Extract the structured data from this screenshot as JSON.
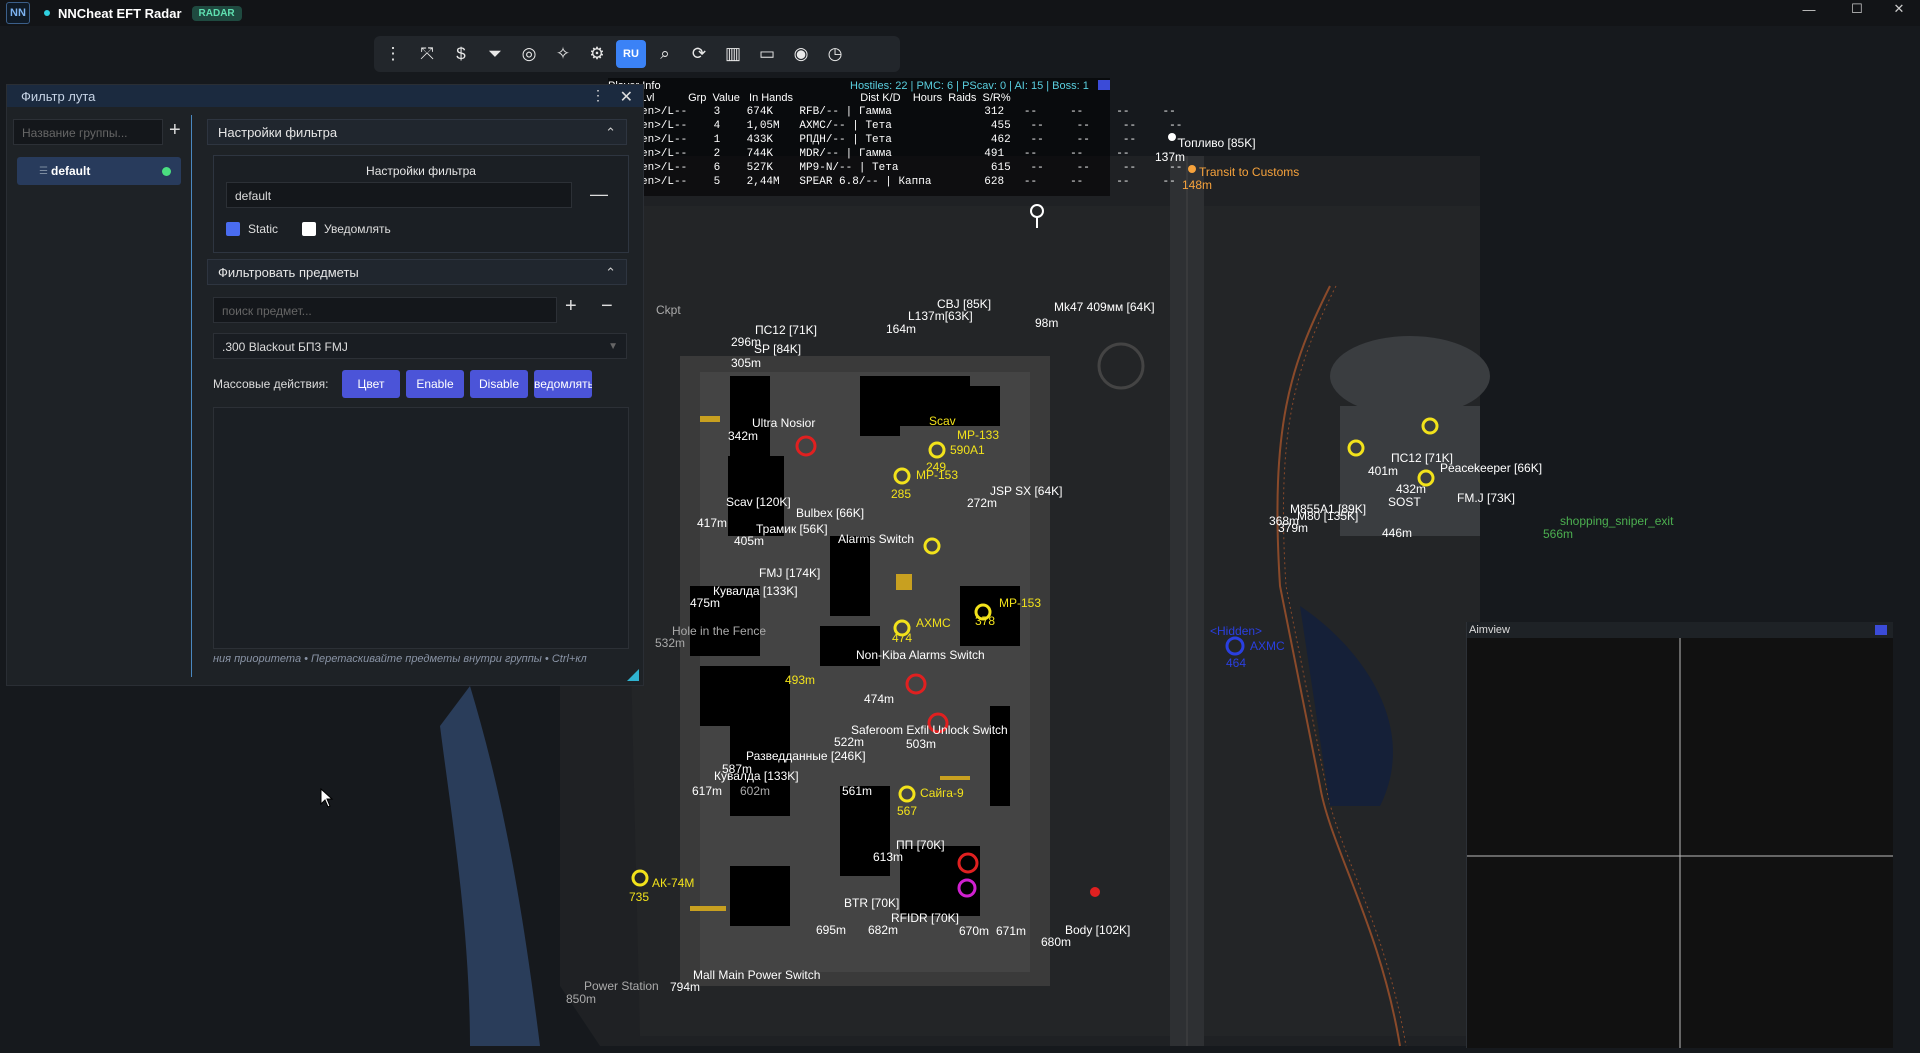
{
  "app": {
    "logo": "NN",
    "title": "NNCheat EFT Radar",
    "badge": "RADAR",
    "win_min": "—",
    "win_max": "☐",
    "win_close": "✕"
  },
  "toolbar": {
    "lang": "RU",
    "icons": [
      "menu-dots-icon",
      "crosshair-icon",
      "dollar-icon",
      "filter-icon",
      "glasses-icon",
      "magic-wand-icon",
      "gear-icon",
      "lang-toggle",
      "search-icon",
      "refresh-icon",
      "map-icon",
      "window-icon",
      "eye-icon",
      "clock-icon"
    ]
  },
  "loot_filter": {
    "title": "Фильтр лута",
    "group_placeholder": "Название группы...",
    "group_name": "default",
    "settings_header": "Настройки фильтра",
    "settings_box_title": "Настройки фильтра",
    "filter_name_value": "default",
    "static_label": "Static",
    "static_checked": true,
    "notify_label": "Уведомлять",
    "notify_checked": false,
    "items_header": "Фильтровать предметы",
    "item_search_placeholder": "поиск предмет...",
    "selected_item": ".300 Blackout БП3 FMJ",
    "mass_label": "Массовые действия:",
    "btn_color": "Цвет",
    "btn_enable": "Enable",
    "btn_disable": "Disable",
    "btn_notify": "ведомлять",
    "hint": "ния приоритета • Перетаскивайте предметы внутри группы • Ctrl+кл"
  },
  "player_info": {
    "header": "Player Info",
    "stats": "Hostiles: 22 | PMC: 6 | PScav: 0 | AI: 15 | Boss: 1",
    "columns": "Name/Lvl           Grp  Value   In Hands                      Dist K/D    Hours  Raids  S/R%",
    "rows": [
      "<Hidden>/L--    3    674K    RFB/-- | Гамма              312   --     --     --     --",
      "<Hidden>/L--    4    1,05M   AXMC/-- | Тета               455   --     --     --     --",
      "<Hidden>/L--    1    433K    РПДН/-- | Тета               462   --     --     --     --",
      "<Hidden>/L--    2    744K    MDR/-- | Гамма              491   --     --     --     --",
      "<Hidden>/L--    6    527K    MP9-N/-- | Тета              615   --     --     --     --",
      "<Hidden>/L--    5    2,44M   SPEAR 6.8/-- | Каппа        628   --     --     --     --"
    ]
  },
  "aimview": {
    "title": "Aimview"
  },
  "map_labels": [
    {
      "t": "Топливо [85K]",
      "c": "#fff"
    },
    {
      "t": "137m",
      "c": "#fff"
    },
    {
      "t": "Transit to Customs",
      "c": "#f6a23c"
    },
    {
      "t": "148m",
      "c": "#f6a23c"
    },
    {
      "t": "CBJ [85K]",
      "c": "#fff"
    },
    {
      "t": "L137m[63K]",
      "c": "#fff"
    },
    {
      "t": "164m",
      "c": "#fff"
    },
    {
      "t": "Mk47 409мм [64K]",
      "c": "#fff"
    },
    {
      "t": "98m",
      "c": "#fff"
    },
    {
      "t": "ПС12 [71K]",
      "c": "#fff"
    },
    {
      "t": "296m",
      "c": "#fff"
    },
    {
      "t": "SP [84K]",
      "c": "#fff"
    },
    {
      "t": "305m",
      "c": "#fff"
    },
    {
      "t": "Ultra Nosior",
      "c": "#fff"
    },
    {
      "t": "342m",
      "c": "#fff"
    },
    {
      "t": "Scav",
      "c": "#f2e21b"
    },
    {
      "t": "MP-133",
      "c": "#f2e21b"
    },
    {
      "t": "590A1",
      "c": "#f2e21b"
    },
    {
      "t": "249",
      "c": "#f2e21b"
    },
    {
      "t": "MP-153",
      "c": "#f2e21b"
    },
    {
      "t": "285",
      "c": "#f2e21b"
    },
    {
      "t": "JSP SX [64K]",
      "c": "#fff"
    },
    {
      "t": "272m",
      "c": "#fff"
    },
    {
      "t": "Bulbex [66K]",
      "c": "#fff"
    },
    {
      "t": "Трамик [56K]",
      "c": "#fff"
    },
    {
      "t": "405m",
      "c": "#fff"
    },
    {
      "t": "Alarms Switch",
      "c": "#fff"
    },
    {
      "t": "FMJ [174K]",
      "c": "#fff"
    },
    {
      "t": "Кувалда [133K]",
      "c": "#fff"
    },
    {
      "t": "475m",
      "c": "#fff"
    },
    {
      "t": "Hole in the Fence",
      "c": "#aaa"
    },
    {
      "t": "532m",
      "c": "#aaa"
    },
    {
      "t": "МР-153",
      "c": "#f2e21b"
    },
    {
      "t": "378",
      "c": "#f2e21b"
    },
    {
      "t": "Non-Kiba Alarms Switch",
      "c": "#fff"
    },
    {
      "t": "493m",
      "c": "#f2e21b"
    },
    {
      "t": "474m",
      "c": "#fff"
    },
    {
      "t": "Saferoom Exfil Unlock Switch",
      "c": "#fff"
    },
    {
      "t": "522m",
      "c": "#fff"
    },
    {
      "t": "503m",
      "c": "#fff"
    },
    {
      "t": "Разведданные [246K]",
      "c": "#fff"
    },
    {
      "t": "587m",
      "c": "#fff"
    },
    {
      "t": "Кувалда [133K]",
      "c": "#fff"
    },
    {
      "t": "617m",
      "c": "#fff"
    },
    {
      "t": "602m",
      "c": "#aaa"
    },
    {
      "t": "561m",
      "c": "#fff"
    },
    {
      "t": "Сайга-9",
      "c": "#f2e21b"
    },
    {
      "t": "567",
      "c": "#f2e21b"
    },
    {
      "t": "ПП [70K]",
      "c": "#fff"
    },
    {
      "t": "613m",
      "c": "#fff"
    },
    {
      "t": "АК-74М",
      "c": "#f2e21b"
    },
    {
      "t": "735",
      "c": "#f2e21b"
    },
    {
      "t": "BTR [70K]",
      "c": "#fff"
    },
    {
      "t": "RFIDR [70K]",
      "c": "#fff"
    },
    {
      "t": "695m",
      "c": "#fff"
    },
    {
      "t": "682m",
      "c": "#fff"
    },
    {
      "t": "670m",
      "c": "#fff"
    },
    {
      "t": "671m",
      "c": "#fff"
    },
    {
      "t": "Body [102K]",
      "c": "#fff"
    },
    {
      "t": "680m",
      "c": "#fff"
    },
    {
      "t": "Mall Main Power Switch",
      "c": "#fff"
    },
    {
      "t": "794m",
      "c": "#fff"
    },
    {
      "t": "Power Station",
      "c": "#aaa"
    },
    {
      "t": "850m",
      "c": "#aaa"
    },
    {
      "t": "Peacekeeper [66K]",
      "c": "#fff"
    },
    {
      "t": "ПС12 [71K]",
      "c": "#fff"
    },
    {
      "t": "FM.J [73K]",
      "c": "#fff"
    },
    {
      "t": "M855A1 [89K]",
      "c": "#fff"
    },
    {
      "t": "M80 [135K]",
      "c": "#fff"
    },
    {
      "t": "SOST",
      "c": "#fff"
    },
    {
      "t": "368m",
      "c": "#fff"
    },
    {
      "t": "379m",
      "c": "#fff"
    },
    {
      "t": "446m",
      "c": "#fff"
    },
    {
      "t": "401m",
      "c": "#fff"
    },
    {
      "t": "432m",
      "c": "#fff"
    },
    {
      "t": "shopping_sniper_exit",
      "c": "#4caf50"
    },
    {
      "t": "566m",
      "c": "#4caf50"
    },
    {
      "t": "<Hidden>",
      "c": "#2a3fe0"
    },
    {
      "t": "AXMC",
      "c": "#2a3fe0"
    },
    {
      "t": "464",
      "c": "#2a3fe0"
    },
    {
      "t": "Scav [120K]",
      "c": "#fff"
    },
    {
      "t": "417m",
      "c": "#fff"
    },
    {
      "t": "AXMC",
      "c": "#f2e21b"
    },
    {
      "t": "474",
      "c": "#f2e21b"
    },
    {
      "t": "Ckpt",
      "c": "#aaa"
    }
  ]
}
